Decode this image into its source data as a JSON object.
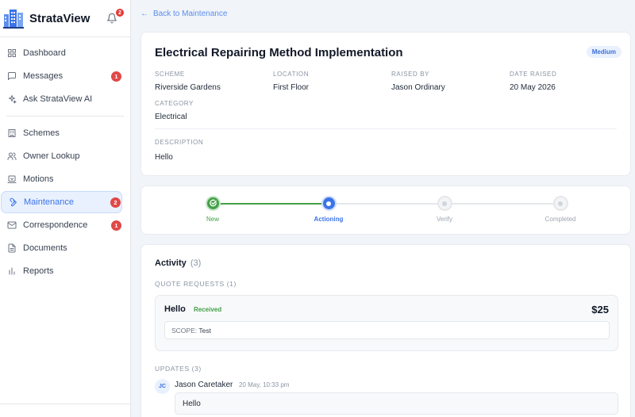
{
  "app": {
    "name": "StrataView",
    "notification_count": "2"
  },
  "sidebar": {
    "groups": [
      [
        {
          "label": "Dashboard",
          "icon": "grid-icon",
          "badge": ""
        },
        {
          "label": "Messages",
          "icon": "chat-icon",
          "badge": "1"
        },
        {
          "label": "Ask StrataView AI",
          "icon": "sparkle-icon",
          "badge": ""
        }
      ],
      [
        {
          "label": "Schemes",
          "icon": "building-icon",
          "badge": ""
        },
        {
          "label": "Owner Lookup",
          "icon": "users-icon",
          "badge": ""
        },
        {
          "label": "Motions",
          "icon": "gavel-icon",
          "badge": ""
        },
        {
          "label": "Maintenance",
          "icon": "wrench-icon",
          "badge": "2",
          "active": true
        },
        {
          "label": "Correspondence",
          "icon": "mail-icon",
          "badge": "1"
        },
        {
          "label": "Documents",
          "icon": "document-icon",
          "badge": ""
        },
        {
          "label": "Reports",
          "icon": "bar-chart-icon",
          "badge": ""
        }
      ]
    ]
  },
  "back_link": "Back to Maintenance",
  "details": {
    "title": "Electrical Repairing Method Implementation",
    "priority": "Medium",
    "scheme_label": "SCHEME",
    "scheme": "Riverside Gardens",
    "location_label": "LOCATION",
    "location": "First Floor",
    "raised_by_label": "RAISED BY",
    "raised_by": "Jason Ordinary",
    "date_label": "DATE RAISED",
    "date": "20 May 2026",
    "category_label": "CATEGORY",
    "category": "Electrical",
    "description_label": "DESCRIPTION",
    "description": "Hello"
  },
  "progress": {
    "steps": [
      {
        "label": "New",
        "state": "done"
      },
      {
        "label": "Actioning",
        "state": "current"
      },
      {
        "label": "Verify",
        "state": "todo"
      },
      {
        "label": "Completed",
        "state": "todo"
      }
    ],
    "colors": {
      "done": "#43a047",
      "current": "#3b73e8",
      "todo": "#e5e7eb"
    }
  },
  "activity": {
    "title": "Activity",
    "count": "(3)",
    "quote_requests_label": "QUOTE REQUESTS (1)",
    "quote": {
      "title": "Hello",
      "status": "Received",
      "amount": "$25",
      "scope_label": "SCOPE:",
      "scope": "Test"
    },
    "updates_label": "UPDATES (3)",
    "update": {
      "initials": "JC",
      "author": "Jason Caretaker",
      "time": "20 May, 10:33 pm",
      "message": "Hello"
    }
  }
}
